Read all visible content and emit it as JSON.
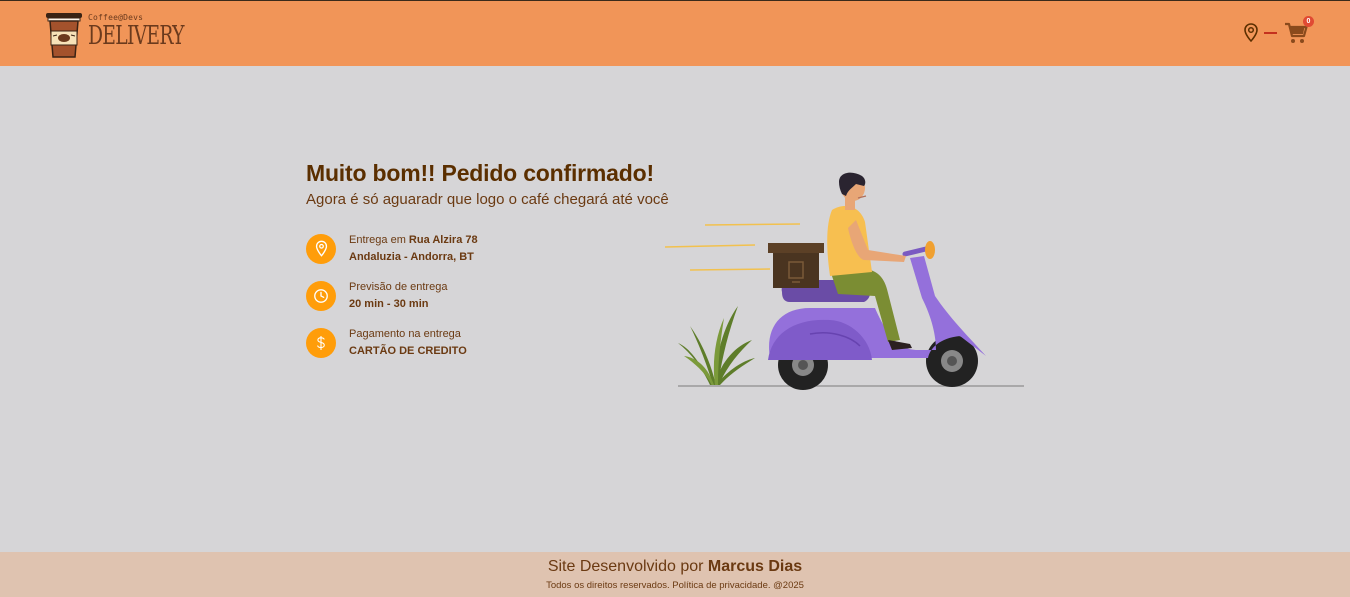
{
  "header": {
    "logo_small": "Coffee@Devs",
    "logo_big": "DELIVERY",
    "cart_count": "0"
  },
  "confirmation": {
    "title": "Muito bom!! Pedido confirmado!",
    "subtitle": "Agora é só aguaradr que logo o café chegará até você",
    "delivery": {
      "prefix": "Entrega em ",
      "street": "Rua Alzira 78",
      "city": "Andaluzia - Andorra, BT"
    },
    "estimate": {
      "label": "Previsão de entrega",
      "value": "20 min - 30 min"
    },
    "payment": {
      "label": "Pagamento na entrega",
      "value": "CARTÃO DE CREDITO"
    }
  },
  "footer": {
    "prefix": "Site Desenvolvido por ",
    "author": "Marcus Dias",
    "legal": "Todos os direitos reservados. Política de privacidade. @2025"
  },
  "colors": {
    "header_bg": "#f19558",
    "accent": "#ff9d0a",
    "text_brown": "#5b2f00",
    "cart_badge": "#e04a33",
    "footer_bg": "#dfc3b0"
  }
}
